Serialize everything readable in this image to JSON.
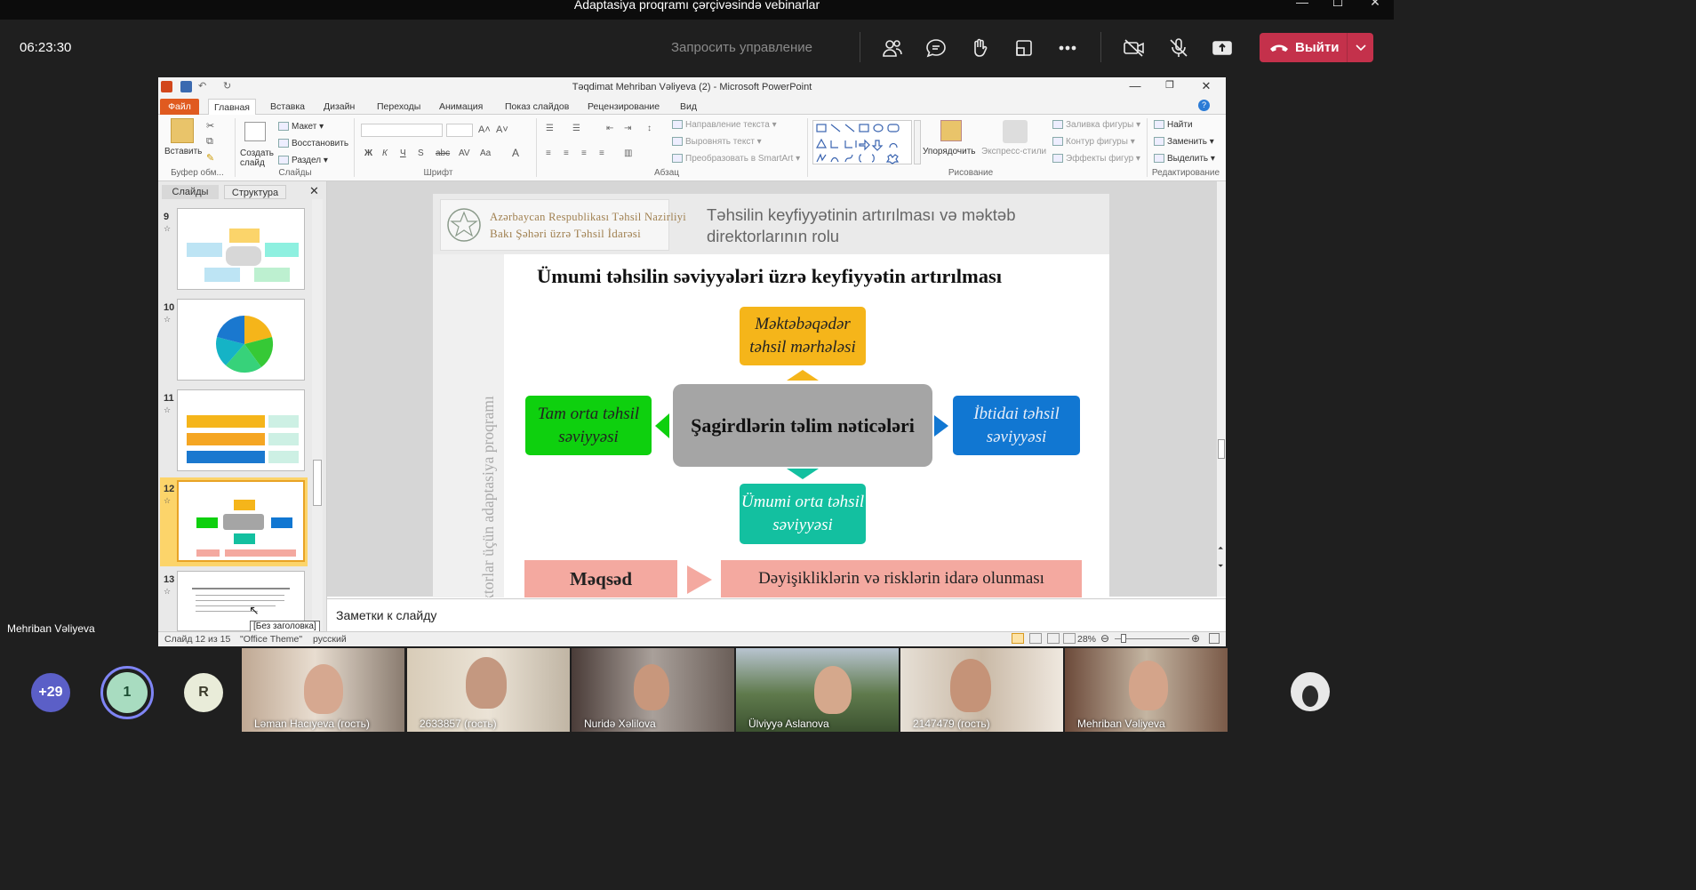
{
  "window": {
    "title": "Adaptasiya proqramı çərçivəsində vebinarlar"
  },
  "meeting": {
    "timer": "06:23:30",
    "request_control": "Запросить управление",
    "leave_label": "Выйти",
    "leave_color": "#c4314b"
  },
  "ppt": {
    "title": "Təqdimat Mehriban Vəliyeva (2)  -  Microsoft PowerPoint",
    "tabs": [
      "Файл",
      "Главная",
      "Вставка",
      "Дизайн",
      "Переходы",
      "Анимация",
      "Показ слайдов",
      "Рецензирование",
      "Вид"
    ],
    "ribbon": {
      "paste": "Вставить",
      "clipboard": "Буфер обм...",
      "new_slide": "Создать слайд",
      "layout": "Макет",
      "reset": "Восстановить",
      "section": "Раздел",
      "slides": "Слайды",
      "font": "Шрифт",
      "paragraph": "Абзац",
      "text_direction": "Направление текста",
      "align_text": "Выровнять текст",
      "smartart": "Преобразовать в SmartArt",
      "arrange": "Упорядочить",
      "quick_styles": "Экспресс-стили",
      "shape_fill": "Заливка фигуры",
      "shape_outline": "Контур фигуры",
      "shape_effects": "Эффекты фигур",
      "drawing": "Рисование",
      "find": "Найти",
      "replace": "Заменить",
      "select": "Выделить",
      "editing": "Редактирование"
    },
    "panel": {
      "tab_slides": "Слайды",
      "tab_outline": "Структура",
      "thumbs": [
        {
          "num": "9",
          "y": 0
        },
        {
          "num": "10",
          "y": 1
        },
        {
          "num": "11",
          "y": 2
        },
        {
          "num": "12",
          "y": 3
        },
        {
          "num": "13",
          "y": 4
        }
      ],
      "tooltip": "[Без заголовка]"
    },
    "notes": "Заметки к слайду",
    "status": {
      "slide": "Слайд 12 из 15",
      "theme": "\"Office Theme\"",
      "lang": "русский",
      "zoom": "28%"
    },
    "slide": {
      "org_line1": "Azərbaycan Respublikası Təhsil Nazirliyi",
      "org_line2": "Bakı Şəhəri üzrə Təhsil İdarəsi",
      "header_title": "Təhsilin keyfiyyətinin artırılması və məktəb direktorlarının rolu",
      "vertical": "Direktorlar üçün adaptasiya proqramı",
      "title": "Ümumi təhsilin səviyyələri üzrə keyfiyyətin artırılması",
      "center": "Şagirdlərin təlim nəticələri",
      "top": "Məktəbəqədər təhsil mərhələsi",
      "left": "Tam orta təhsil səviyyəsi",
      "right": "İbtidai təhsil səviyyəsi",
      "bottom": "Ümumi orta təhsil səviyyəsi",
      "goal": "Məqsəd",
      "goal_text": "Dəyişikliklərin və risklərin idarə olunması",
      "colors": {
        "top": "#f5b51a",
        "left": "#0ed00e",
        "right": "#1177d2",
        "bottom": "#13c0a0",
        "center": "#a5a5a5",
        "goal": "#f4a9a0"
      }
    }
  },
  "participants": {
    "more": "+29",
    "badge1": "1",
    "badgeR": "R",
    "presenter": "Mehriban Vəliyeva",
    "tiles": [
      {
        "name": "Ləman Hacıyeva (гость)"
      },
      {
        "name": "2633857 (гость)"
      },
      {
        "name": "Nuridə Xəlilova"
      },
      {
        "name": "Ülviyyə Aslanova"
      },
      {
        "name": "2147479 (гость)"
      },
      {
        "name": "Mehriban Vəliyeva"
      }
    ]
  }
}
